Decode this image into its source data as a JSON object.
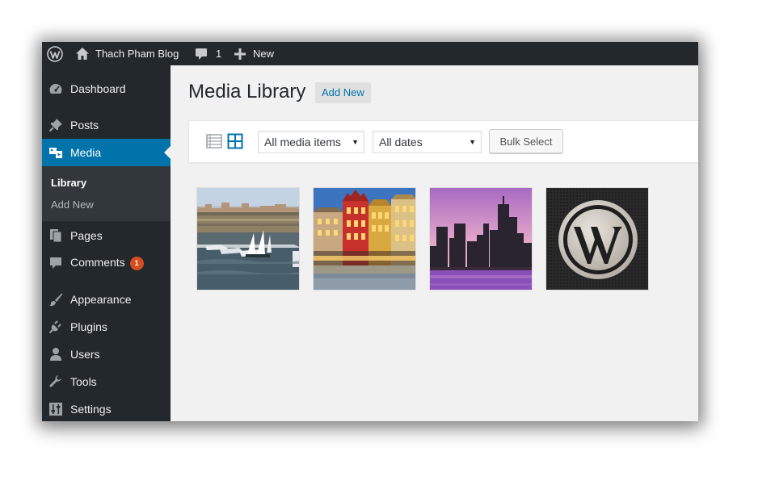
{
  "adminbar": {
    "site_name": "Thach Pham Blog",
    "comments_count": "1",
    "new_label": "New",
    "icons": [
      "wordpress-logo-icon",
      "home-icon",
      "comment-bubble-icon",
      "plus-icon"
    ]
  },
  "sidebar": {
    "dashboard": "Dashboard",
    "posts": "Posts",
    "media": "Media",
    "submenu": {
      "library": "Library",
      "add_new": "Add New"
    },
    "pages": "Pages",
    "comments": "Comments",
    "comments_badge": "1",
    "appearance": "Appearance",
    "plugins": "Plugins",
    "users": "Users",
    "tools": "Tools",
    "settings": "Settings"
  },
  "main": {
    "title": "Media Library",
    "add_new": "Add New",
    "toolbar": {
      "views": [
        "list-view-icon",
        "grid-view-icon"
      ],
      "active_view": "grid",
      "filter_type": "All media items",
      "filter_date": "All dates",
      "bulk_select": "Bulk Select"
    },
    "media_items": [
      {
        "subject": "harbor with sailboats"
      },
      {
        "subject": "colorful houses at night"
      },
      {
        "subject": "city skyline at sunset"
      },
      {
        "subject": "wordpress logo"
      }
    ]
  },
  "colors": {
    "adminbar": "#23282d",
    "sidebar": "#23282d",
    "submenu": "#32373c",
    "accent": "#0073aa",
    "badge": "#d54e21",
    "content_bg": "#f1f1f1"
  }
}
